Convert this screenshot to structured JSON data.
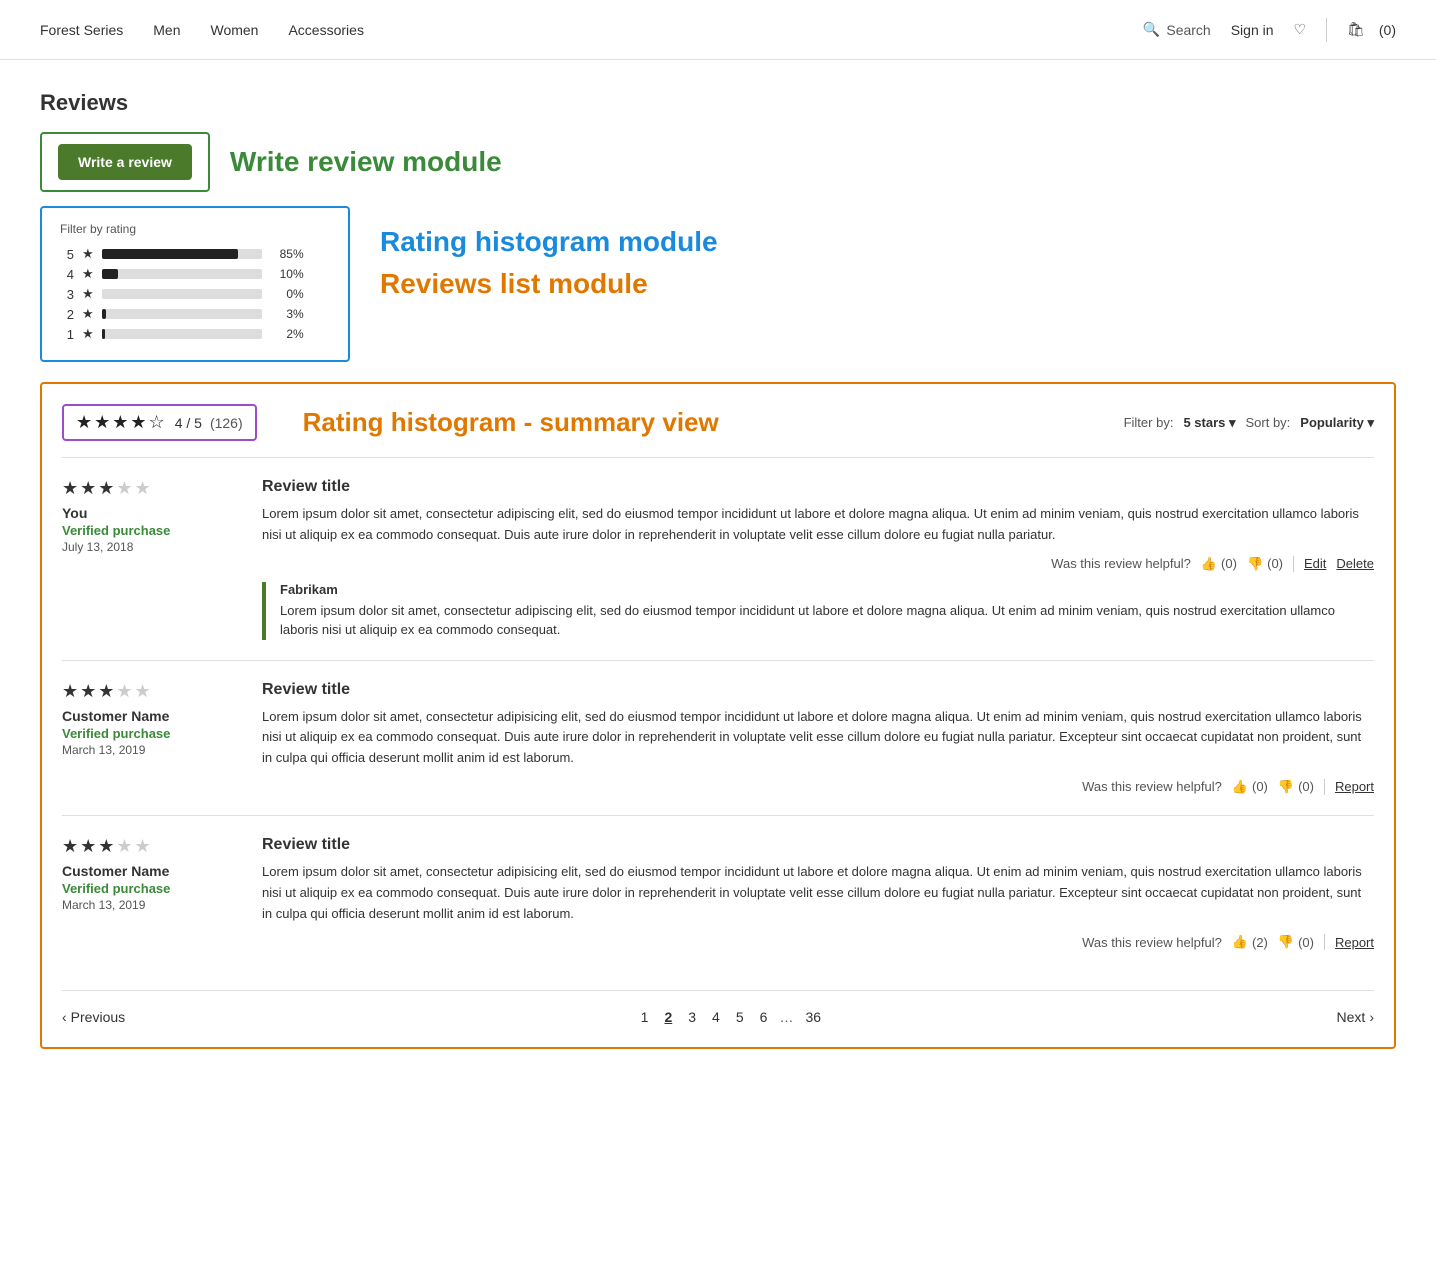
{
  "nav": {
    "links": [
      "Forest Series",
      "Men",
      "Women",
      "Accessories"
    ],
    "search_label": "Search",
    "signin_label": "Sign in",
    "cart_count": "(0)"
  },
  "page": {
    "title": "Reviews"
  },
  "write_review": {
    "button_label": "Write a review",
    "module_label": "Write review module"
  },
  "histogram": {
    "filter_label": "Filter by rating",
    "module_label": "Rating histogram module",
    "rows": [
      {
        "num": "5",
        "pct": "85%",
        "fill_pct": 85
      },
      {
        "num": "4",
        "pct": "10%",
        "fill_pct": 10
      },
      {
        "num": "3",
        "pct": "0%",
        "fill_pct": 0
      },
      {
        "num": "2",
        "pct": "3%",
        "fill_pct": 3
      },
      {
        "num": "1",
        "pct": "2%",
        "fill_pct": 2
      }
    ]
  },
  "reviews_list_module_label": "Reviews list module",
  "summary": {
    "stars": "★★★★☆",
    "rating": "4 / 5",
    "count": "(126)",
    "module_label": "Rating histogram - summary view",
    "filter_label": "Filter by:",
    "filter_value": "5 stars ▾",
    "sort_label": "Sort by:",
    "sort_value": "Popularity ▾"
  },
  "reviews": [
    {
      "stars": "★★★☆☆",
      "stars_empty": "★★",
      "reviewer": "You",
      "verified": "Verified purchase",
      "date": "July 13, 2018",
      "title": "Review title",
      "body": "Lorem ipsum dolor sit amet, consectetur adipiscing elit, sed do eiusmod tempor incididunt ut labore et dolore magna aliqua. Ut enim ad minim veniam, quis nostrud exercitation ullamco laboris nisi ut aliquip ex ea commodo consequat. Duis aute irure dolor in reprehenderit in voluptate velit esse cillum dolore eu fugiat nulla pariatur.",
      "helpful_text": "Was this review helpful?",
      "thumbs_up": "👍",
      "thumbs_up_count": "(0)",
      "thumbs_down": "👎",
      "thumbs_down_count": "(0)",
      "action1": "Edit",
      "action2": "Delete",
      "has_reply": true,
      "reply": {
        "name": "Fabrikam",
        "body": "Lorem ipsum dolor sit amet, consectetur adipiscing elit, sed do eiusmod tempor incididunt ut labore et dolore magna aliqua. Ut enim ad minim veniam, quis nostrud exercitation ullamco laboris nisi ut aliquip ex ea commodo consequat."
      }
    },
    {
      "stars": "★★★☆☆",
      "reviewer": "Customer Name",
      "verified": "Verified purchase",
      "date": "March 13, 2019",
      "title": "Review title",
      "body": "Lorem ipsum dolor sit amet, consectetur adipisicing elit, sed do eiusmod tempor incididunt ut labore et dolore magna aliqua. Ut enim ad minim veniam, quis nostrud exercitation ullamco laboris nisi ut aliquip ex ea commodo consequat. Duis aute irure dolor in reprehenderit in voluptate velit esse cillum dolore eu fugiat nulla pariatur. Excepteur sint occaecat cupidatat non proident, sunt in culpa qui officia deserunt mollit anim id est laborum.",
      "helpful_text": "Was this review helpful?",
      "thumbs_up": "👍",
      "thumbs_up_count": "(0)",
      "thumbs_down": "👎",
      "thumbs_down_count": "(0)",
      "action1": "Report",
      "has_reply": false
    },
    {
      "stars": "★★★☆☆",
      "reviewer": "Customer Name",
      "verified": "Verified purchase",
      "date": "March 13, 2019",
      "title": "Review title",
      "body": "Lorem ipsum dolor sit amet, consectetur adipisicing elit, sed do eiusmod tempor incididunt ut labore et dolore magna aliqua. Ut enim ad minim veniam, quis nostrud exercitation ullamco laboris nisi ut aliquip ex ea commodo consequat. Duis aute irure dolor in reprehenderit in voluptate velit esse cillum dolore eu fugiat nulla pariatur. Excepteur sint occaecat cupidatat non proident, sunt in culpa qui officia deserunt mollit anim id est laborum.",
      "helpful_text": "Was this review helpful?",
      "thumbs_up": "👍",
      "thumbs_up_count": "(2)",
      "thumbs_down": "👎",
      "thumbs_down_count": "(0)",
      "action1": "Report",
      "has_reply": false
    }
  ],
  "pagination": {
    "prev_label": "Previous",
    "next_label": "Next",
    "pages": [
      "1",
      "2",
      "3",
      "4",
      "5",
      "6",
      "...",
      "36"
    ],
    "active_page": "2"
  }
}
